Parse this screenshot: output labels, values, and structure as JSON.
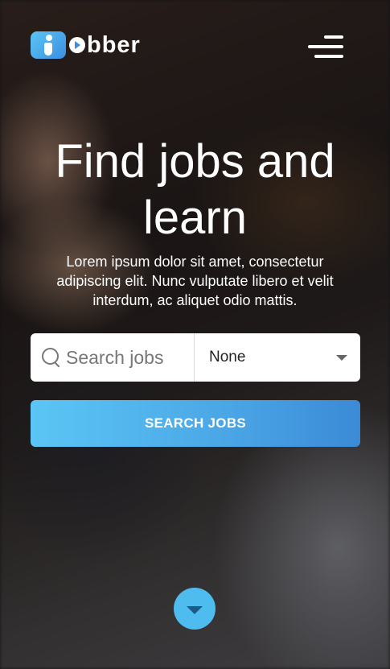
{
  "header": {
    "logo_text": "bber",
    "logo_icon": "jobber-logo-icon",
    "menu_icon": "hamburger-menu-icon"
  },
  "hero": {
    "title": "Find jobs and learn",
    "subtitle": "Lorem ipsum dolor sit amet, consectetur adipiscing elit. Nunc vulputate libero et velit interdum, ac aliquet odio mattis."
  },
  "search": {
    "placeholder": "Search jobs",
    "value": "",
    "category_selected": "None",
    "button_label": "SEARCH JOBS"
  },
  "scroll": {
    "icon": "chevron-down-icon"
  },
  "colors": {
    "accent": "#4fbcf0",
    "accent_dark": "#3b8ad6",
    "text_light": "#ffffff"
  }
}
